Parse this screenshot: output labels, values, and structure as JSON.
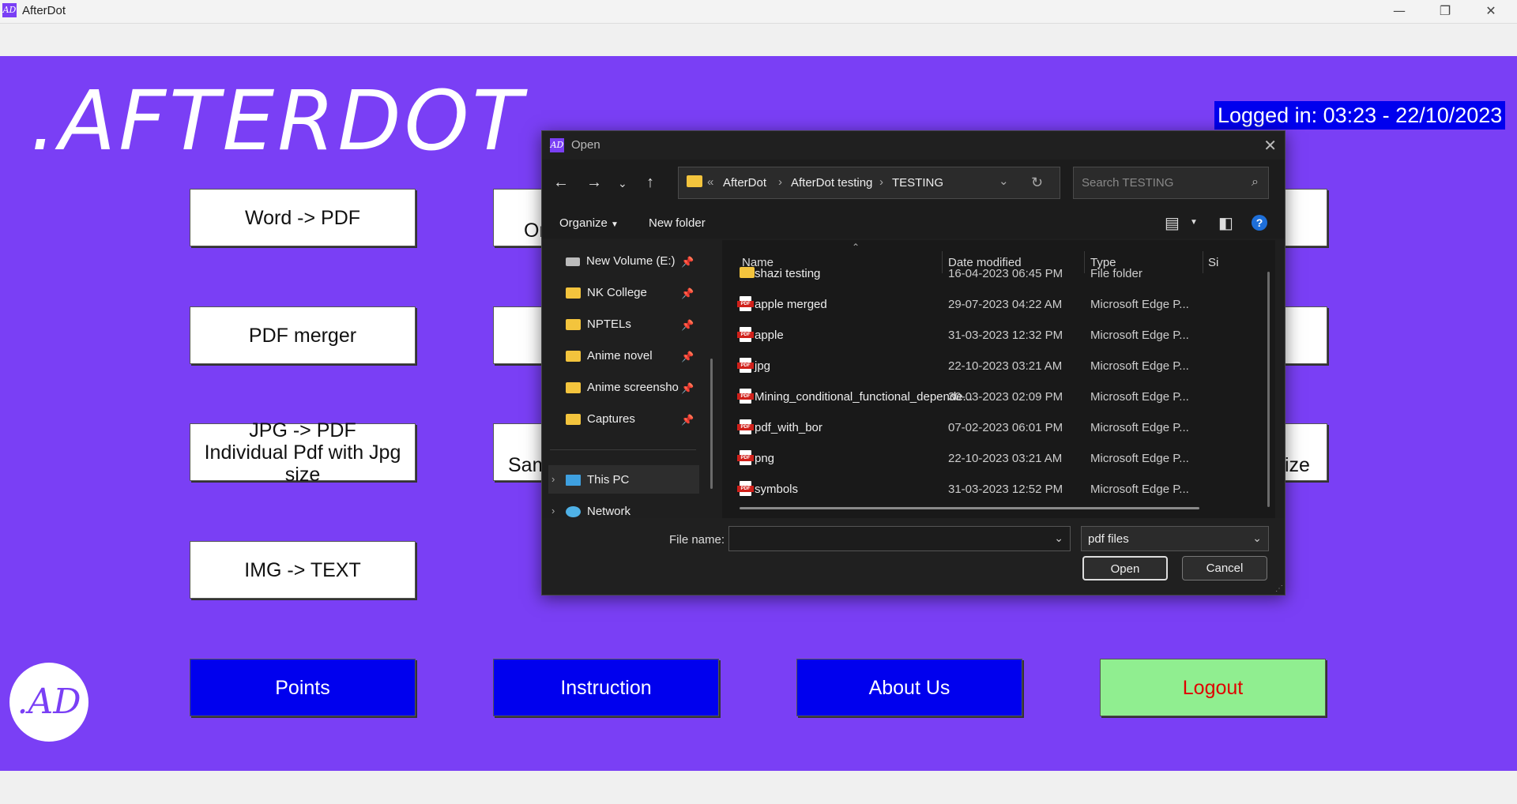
{
  "app": {
    "title": "AfterDot",
    "icon_text": "AD"
  },
  "window_controls": {
    "minimize": "—",
    "maximize": "❐",
    "close": "✕"
  },
  "main": {
    "logo": ".AFTERDOT",
    "logged_in": "Logged in: 03:23 - 22/10/2023",
    "buttons": {
      "word_pdf": "Word -> PDF",
      "pdf_merger": "PDF merger",
      "jpg_pdf_line1": "JPG -> PDF",
      "jpg_pdf_line2": "Individual Pdf with Jpg size",
      "img_text": "IMG -> TEXT",
      "partial_1": "Or",
      "partial_3": "Sam",
      "partial_right_3": "ize",
      "points": "Points",
      "instruction": "Instruction",
      "about_us": "About Us",
      "logout": "Logout"
    },
    "avatar_text": ".AD",
    "colors": {
      "background": "#7a3ff5",
      "blue_button": "#0000ee",
      "logout_bg": "#90ee90",
      "logout_text": "#e00000"
    }
  },
  "dialog": {
    "title": "Open",
    "breadcrumb": [
      "AfterDot",
      "AfterDot testing",
      "TESTING"
    ],
    "search_placeholder": "Search TESTING",
    "toolbar": {
      "organize": "Organize",
      "new_folder": "New folder"
    },
    "nav_items": [
      {
        "label": "New Volume (E:)"
      },
      {
        "label": "NK College"
      },
      {
        "label": "NPTELs"
      },
      {
        "label": "Anime novel"
      },
      {
        "label": "Anime screensho"
      },
      {
        "label": "Captures"
      },
      {
        "label": "This PC"
      },
      {
        "label": "Network"
      }
    ],
    "columns": {
      "name": "Name",
      "date": "Date modified",
      "type": "Type",
      "size": "Si"
    },
    "files": [
      {
        "name": "shazi testing",
        "date": "16-04-2023 06:45 PM",
        "type": "File folder",
        "icon": "folder-icon"
      },
      {
        "name": "apple merged",
        "date": "29-07-2023 04:22 AM",
        "type": "Microsoft Edge P...",
        "icon": "pdf-icon"
      },
      {
        "name": "apple",
        "date": "31-03-2023 12:32 PM",
        "type": "Microsoft Edge P...",
        "icon": "pdf-icon"
      },
      {
        "name": "jpg",
        "date": "22-10-2023 03:21 AM",
        "type": "Microsoft Edge P...",
        "icon": "pdf-icon"
      },
      {
        "name": "Mining_conditional_functional_depende...",
        "date": "30-03-2023 02:09 PM",
        "type": "Microsoft Edge P...",
        "icon": "pdf-icon"
      },
      {
        "name": "pdf_with_bor",
        "date": "07-02-2023 06:01 PM",
        "type": "Microsoft Edge P...",
        "icon": "pdf-icon"
      },
      {
        "name": "png",
        "date": "22-10-2023 03:21 AM",
        "type": "Microsoft Edge P...",
        "icon": "pdf-icon"
      },
      {
        "name": "symbols",
        "date": "31-03-2023 12:52 PM",
        "type": "Microsoft Edge P...",
        "icon": "pdf-icon"
      }
    ],
    "file_name_label": "File name:",
    "file_name_value": "",
    "file_type": "pdf files",
    "open_button": "Open",
    "cancel_button": "Cancel"
  }
}
